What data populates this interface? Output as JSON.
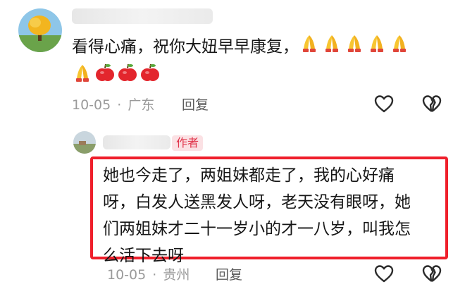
{
  "comment1": {
    "text": "看得心痛，祝你大妞早早康复，",
    "emoji": [
      "pray",
      "pray",
      "pray",
      "pray",
      "pray",
      "pray",
      "apple",
      "apple",
      "apple"
    ],
    "date": "10-05",
    "separator": "·",
    "location": "广东",
    "reply_label": "回复"
  },
  "comment2": {
    "author_tag": "作者",
    "text_lines": [
      "她也今走了，两姐妹都走了，我的心好痛",
      "呀，白发人送黑发人呀，老天没有眼呀，她",
      "们两姐妹才二十一岁小的才一八岁，叫我怎",
      "么活下去呀"
    ],
    "date": "10-05",
    "separator": "·",
    "location": "贵州",
    "reply_label": "回复"
  },
  "colors": {
    "highlight": "#ef1f2b",
    "author_tag_bg": "#fbe1e4",
    "author_tag_fg": "#e0344a"
  },
  "icons": [
    "like-heart-icon",
    "dislike-broken-heart-icon"
  ]
}
